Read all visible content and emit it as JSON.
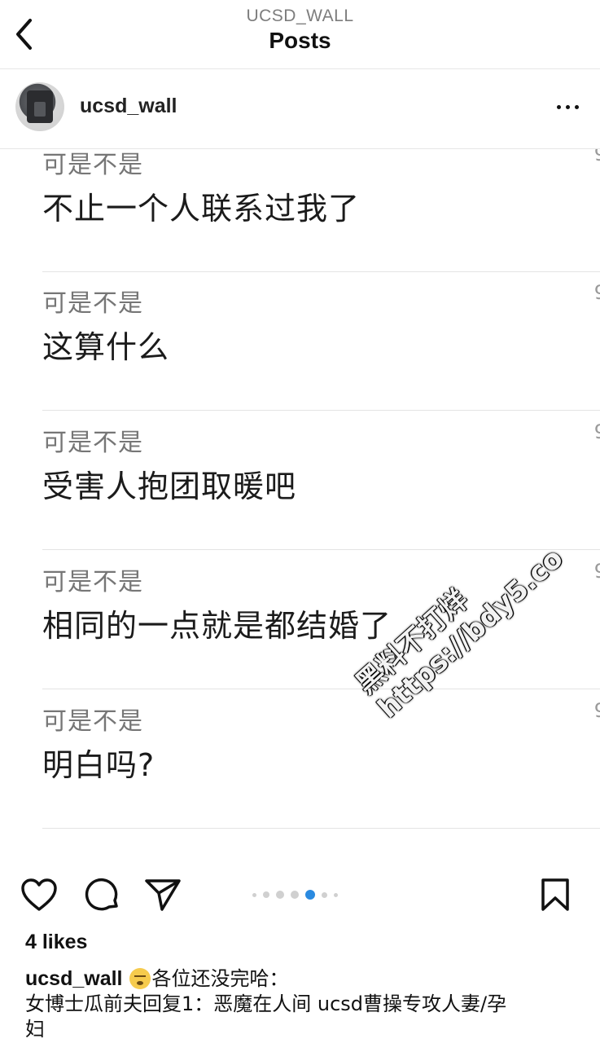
{
  "header": {
    "subtitle": "UCSD_WALL",
    "title": "Posts"
  },
  "post": {
    "author": "ucsd_wall",
    "comments": [
      {
        "author": "可是不是",
        "text": "不止一个人联系过我了",
        "meta": "9"
      },
      {
        "author": "可是不是",
        "text": "这算什么",
        "meta": "9"
      },
      {
        "author": "可是不是",
        "text": "受害人抱团取暖吧",
        "meta": "9"
      },
      {
        "author": "可是不是",
        "text": "相同的一点就是都结婚了",
        "meta": "9"
      },
      {
        "author": "可是不是",
        "text": "明白吗?",
        "meta": "9"
      }
    ],
    "watermark": {
      "line1": "黑料不打烊",
      "line2": "https://bdy5.co"
    },
    "carousel": {
      "total": 7,
      "active_index": 3
    },
    "likes": "4 likes",
    "caption": {
      "user": "ucsd_wall",
      "emoji": "weary-face-emoji",
      "line1": "各位还没完哈：",
      "line2": "女博士瓜前夫回复1：恶魔在人间 ucsd曹操专攻人妻/孕",
      "line3": "妇"
    }
  },
  "icons": {
    "back": "chevron-left-icon",
    "more": "more-horizontal-icon",
    "like": "heart-icon",
    "comment": "comment-bubble-icon",
    "share": "paper-plane-icon",
    "save": "bookmark-icon"
  },
  "colors": {
    "active_dot": "#2a8ae0",
    "inactive_dot": "#d0d0d0"
  }
}
